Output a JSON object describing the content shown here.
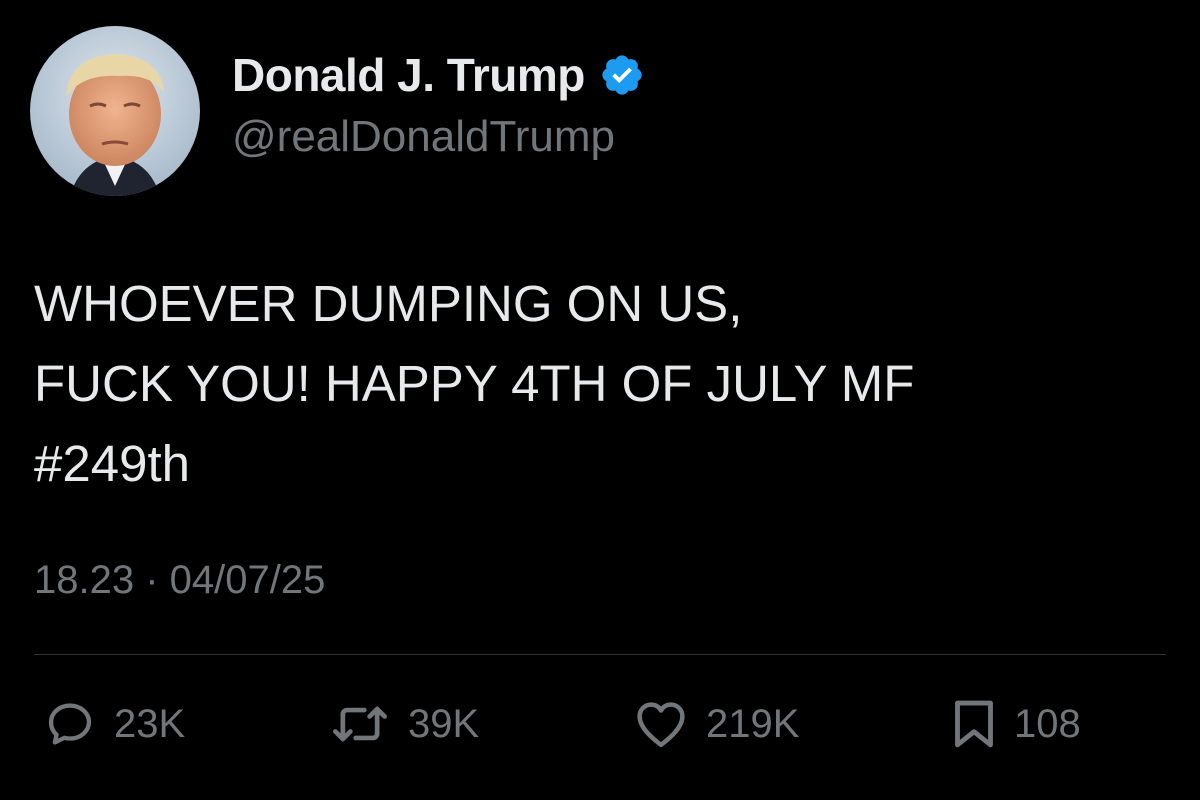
{
  "author": {
    "display_name": "Donald J. Trump",
    "handle": "@realDonaldTrump",
    "verified": true
  },
  "post": {
    "lines": [
      "WHOEVER DUMPING ON US,",
      "FUCK YOU! HAPPY 4TH OF JULY MF",
      "#249th"
    ],
    "timestamp": "18.23 · 04/07/25"
  },
  "actions": {
    "reply": {
      "icon": "reply-icon",
      "count": "23K"
    },
    "repost": {
      "icon": "repost-icon",
      "count": "39K"
    },
    "like": {
      "icon": "heart-icon",
      "count": "219K"
    },
    "bookmark": {
      "icon": "bookmark-icon",
      "count": "108"
    }
  },
  "colors": {
    "background": "#000000",
    "text_primary": "#e7e9ea",
    "text_secondary": "#71767b",
    "verified_badge": "#1d9bf0",
    "divider": "#2f3336"
  }
}
